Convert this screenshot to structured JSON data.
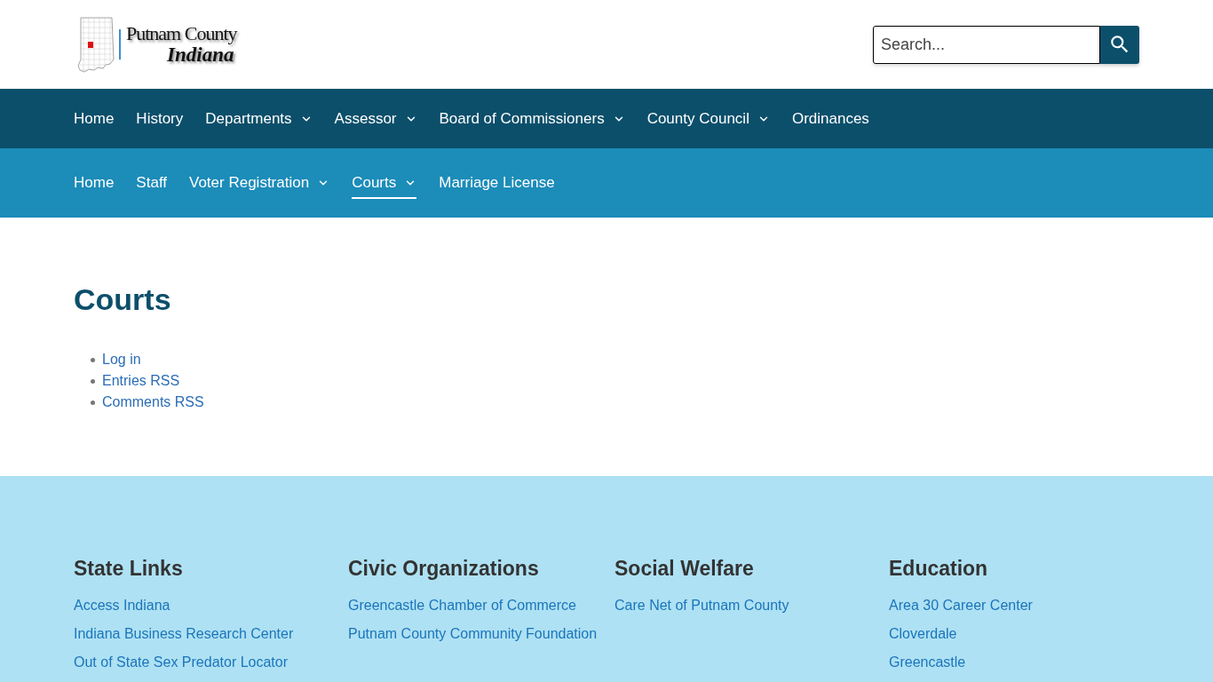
{
  "header": {
    "logo": {
      "title": "Putnam County",
      "subtitle": "Indiana"
    },
    "search": {
      "placeholder": "Search..."
    }
  },
  "main_nav": {
    "items": [
      {
        "label": "Home",
        "has_submenu": false
      },
      {
        "label": "History",
        "has_submenu": false
      },
      {
        "label": "Departments",
        "has_submenu": true
      },
      {
        "label": "Assessor",
        "has_submenu": true
      },
      {
        "label": "Board of Commissioners",
        "has_submenu": true
      },
      {
        "label": "County Council",
        "has_submenu": true
      },
      {
        "label": "Ordinances",
        "has_submenu": false
      }
    ]
  },
  "sub_nav": {
    "items": [
      {
        "label": "Home",
        "has_submenu": false,
        "selected": false
      },
      {
        "label": "Staff",
        "has_submenu": false,
        "selected": false
      },
      {
        "label": "Voter Registration",
        "has_submenu": true,
        "selected": false
      },
      {
        "label": "Courts",
        "has_submenu": true,
        "selected": true
      },
      {
        "label": "Marriage License",
        "has_submenu": false,
        "selected": false
      }
    ]
  },
  "page": {
    "title": "Courts",
    "links": [
      "Log in",
      "Entries RSS",
      "Comments RSS"
    ]
  },
  "footer": {
    "columns": [
      {
        "heading": "State Links",
        "links": [
          "Access Indiana",
          "Indiana Business Research Center",
          "Out of State Sex Predator Locator"
        ]
      },
      {
        "heading": "Civic Organizations",
        "links": [
          "Greencastle Chamber of Commerce",
          "Putnam County Community Foundation"
        ]
      },
      {
        "heading": "Social Welfare",
        "links": [
          "Care Net of Putnam County"
        ]
      },
      {
        "heading": "Education",
        "links": [
          "Area 30 Career Center",
          "Cloverdale",
          "Greencastle"
        ]
      }
    ]
  }
}
